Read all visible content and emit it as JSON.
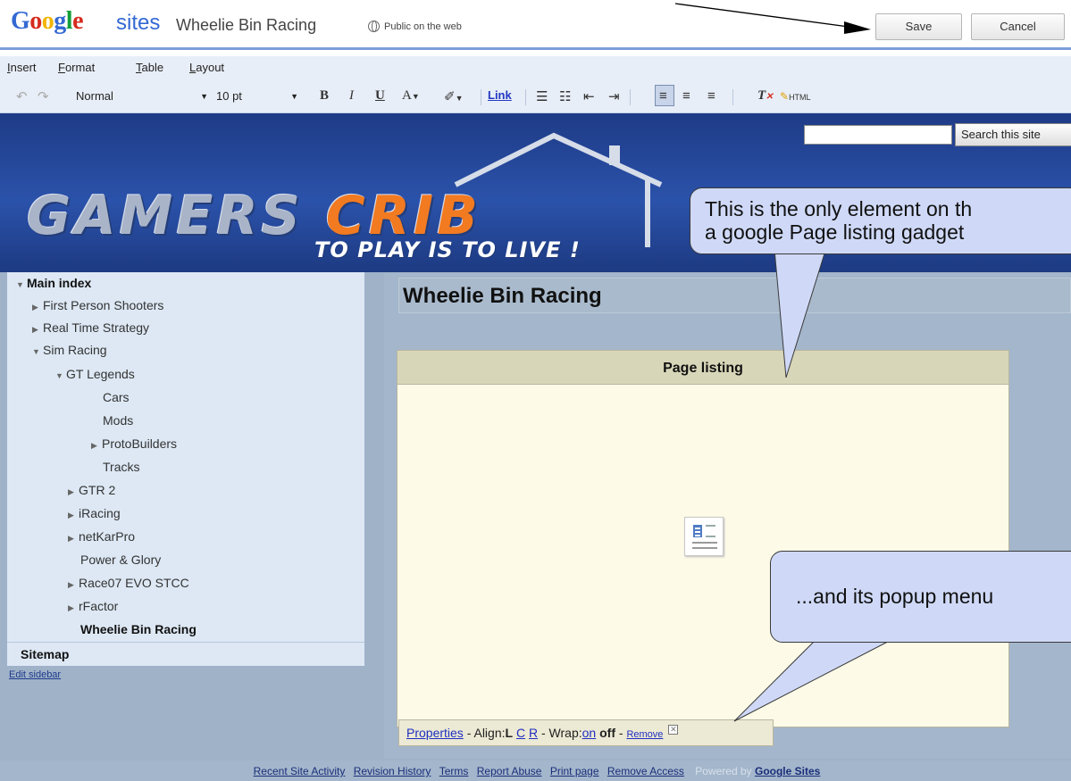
{
  "header": {
    "logo_google": "Google",
    "logo_sites": "sites",
    "site_name": "Wheelie Bin Racing",
    "visibility": "Public on the web",
    "save_label": "Save",
    "cancel_label": "Cancel"
  },
  "menubar": {
    "items": [
      {
        "first": "I",
        "rest": "nsert"
      },
      {
        "first": "F",
        "rest": "ormat"
      },
      {
        "first": "T",
        "rest": "able"
      },
      {
        "first": "L",
        "rest": "ayout"
      }
    ]
  },
  "toolbar": {
    "style_value": "Normal",
    "size_value": "10 pt",
    "bold": "B",
    "italic": "I",
    "underline": "U",
    "font_color": "A",
    "link": "Link",
    "html": "HTML",
    "icons": [
      "undo-icon",
      "redo-icon",
      "bold-icon",
      "italic-icon",
      "underline-icon",
      "text-color-icon",
      "highlight-icon",
      "numbered-list-icon",
      "bulleted-list-icon",
      "indent-less-icon",
      "indent-more-icon",
      "align-left-icon",
      "align-center-icon",
      "align-right-icon",
      "remove-formatting-icon",
      "edit-html-icon"
    ]
  },
  "banner": {
    "search_button": "Search this site",
    "logo_text_1": "GAMERS",
    "logo_text_2": "CRIB",
    "tagline": "TO PLAY IS TO LIVE !"
  },
  "sidebar": {
    "main_index": "Main index",
    "items": [
      {
        "label": "First Person Shooters",
        "indent": 1,
        "arrow": "right"
      },
      {
        "label": "Real Time Strategy",
        "indent": 1,
        "arrow": "right"
      },
      {
        "label": "Sim Racing",
        "indent": 1,
        "arrow": "down"
      },
      {
        "label": "GT Legends",
        "indent": 2,
        "arrow": "down"
      },
      {
        "label": "Cars",
        "indent": 3,
        "arrow": "none"
      },
      {
        "label": "Mods",
        "indent": 3,
        "arrow": "none"
      },
      {
        "label": "ProtoBuilders",
        "indent": 3,
        "arrow": "right"
      },
      {
        "label": "Tracks",
        "indent": 3,
        "arrow": "none"
      },
      {
        "label": "GTR 2",
        "indent": 2,
        "arrow": "right"
      },
      {
        "label": "iRacing",
        "indent": 2,
        "arrow": "right"
      },
      {
        "label": "netKarPro",
        "indent": 2,
        "arrow": "right"
      },
      {
        "label": "Power & Glory",
        "indent": 2,
        "arrow": "none"
      },
      {
        "label": "Race07 EVO STCC",
        "indent": 2,
        "arrow": "right"
      },
      {
        "label": "rFactor",
        "indent": 2,
        "arrow": "right"
      },
      {
        "label": "Wheelie Bin Racing",
        "indent": 2,
        "arrow": "none",
        "current": true
      }
    ],
    "sitemap": "Sitemap",
    "edit_sidebar": "Edit sidebar"
  },
  "main": {
    "page_title": "Wheelie Bin Racing",
    "gadget_title": "Page listing"
  },
  "popup": {
    "properties": "Properties",
    "align_label": "- Align:",
    "align_l": "L",
    "align_c": "C",
    "align_r": "R",
    "wrap_label": "- Wrap:",
    "wrap_on": "on",
    "wrap_off": "off",
    "dash": "-",
    "remove": "Remove"
  },
  "callouts": {
    "gadget_note_line1": "This is the only element on th",
    "gadget_note_line2": "a google Page listing gadget",
    "menu_note": "...and its popup menu"
  },
  "footer": {
    "links": [
      "Recent Site Activity",
      "Revision History",
      "Terms",
      "Report Abuse",
      "Print page",
      "Remove Access"
    ],
    "powered_by": "Powered by",
    "google_sites": "Google Sites"
  },
  "colors": {
    "accent": "#7c9ed9",
    "link": "#1f2fc0",
    "callout_fill": "#cfd9f7",
    "banner": "#2b52aa"
  }
}
